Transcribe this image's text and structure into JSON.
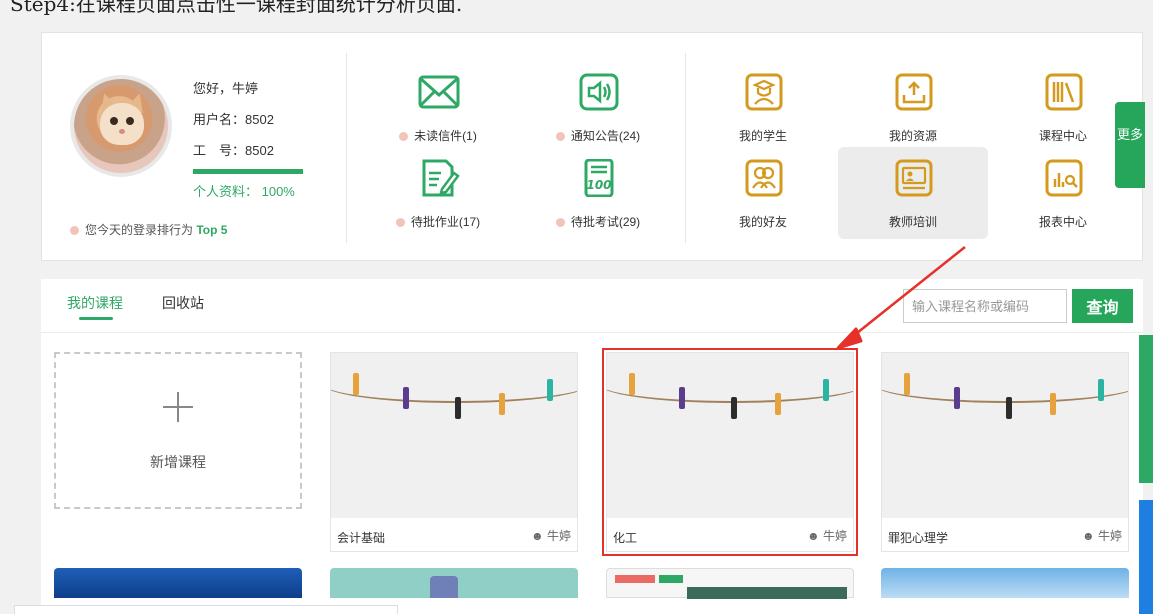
{
  "caption": "Step4:在课程页面点击性一课程封面统计分析页面.",
  "profile": {
    "greeting": "您好，牛婷",
    "username": "用户名：8502",
    "staff_no": "工　号：8502",
    "completeness_label": "个人资料： 100%",
    "completeness": 100,
    "rank_prefix": "您今天的登录排行为",
    "rank_value": "Top 5"
  },
  "notifications": [
    {
      "label": "未读信件(1)",
      "icon": "envelope-icon"
    },
    {
      "label": "通知公告(24)",
      "icon": "speaker-icon"
    },
    {
      "label": "待批作业(17)",
      "icon": "homework-icon"
    },
    {
      "label": "待批考试(29)",
      "icon": "exam-score-icon"
    }
  ],
  "shortcuts": [
    {
      "label": "我的学生",
      "icon": "student-icon"
    },
    {
      "label": "我的资源",
      "icon": "upload-resource-icon"
    },
    {
      "label": "课程中心",
      "icon": "books-icon"
    },
    {
      "label": "我的好友",
      "icon": "friends-icon"
    },
    {
      "label": "教师培训",
      "icon": "teacher-training-icon"
    },
    {
      "label": "报表中心",
      "icon": "report-icon"
    }
  ],
  "more_label": "更多",
  "tabs": {
    "mine": "我的课程",
    "bin": "回收站"
  },
  "search": {
    "placeholder": "输入课程名称或编码",
    "button": "查询"
  },
  "new_course_label": "新增课程",
  "courses": [
    {
      "name": "会计基础",
      "owner": "牛婷"
    },
    {
      "name": "化工",
      "owner": "牛婷"
    },
    {
      "name": "罪犯心理学",
      "owner": "牛婷"
    }
  ],
  "colors": {
    "accent": "#2ea865",
    "highlight": "#e6312a",
    "gold": "#d49a1e"
  }
}
